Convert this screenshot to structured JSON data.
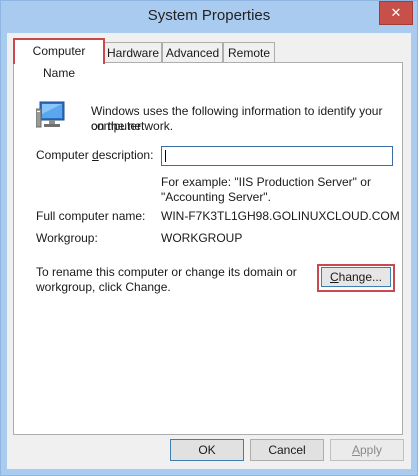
{
  "window": {
    "title": "System Properties",
    "close_glyph": "✕"
  },
  "tabs": [
    {
      "label": "Computer Name",
      "active": true
    },
    {
      "label": "Hardware",
      "active": false
    },
    {
      "label": "Advanced",
      "active": false
    },
    {
      "label": "Remote",
      "active": false
    }
  ],
  "panel": {
    "intro_line1": "Windows uses the following information to identify your computer",
    "intro_line2": "on the network.",
    "description_label_pre": "Computer ",
    "description_label_mnemonic": "d",
    "description_label_post": "escription:",
    "description_value": "",
    "example_line1": "For example: \"IIS Production Server\" or",
    "example_line2": "\"Accounting Server\".",
    "full_name_label": "Full computer name:",
    "full_name_value": "WIN-F7K3TL1GH98.GOLINUXCLOUD.COM",
    "workgroup_label": "Workgroup:",
    "workgroup_value": "WORKGROUP",
    "rename_line1": "To rename this computer or change its domain or",
    "rename_line2": "workgroup, click Change.",
    "change_mnemonic": "C",
    "change_rest": "hange...",
    "computer_icon": "computer-icon"
  },
  "buttons": {
    "ok": "OK",
    "cancel": "Cancel",
    "apply_mnemonic": "A",
    "apply_rest": "pply"
  },
  "colors": {
    "title_bar": "#aacbf0",
    "highlight": "#c9494f",
    "close": "#c7504a"
  }
}
